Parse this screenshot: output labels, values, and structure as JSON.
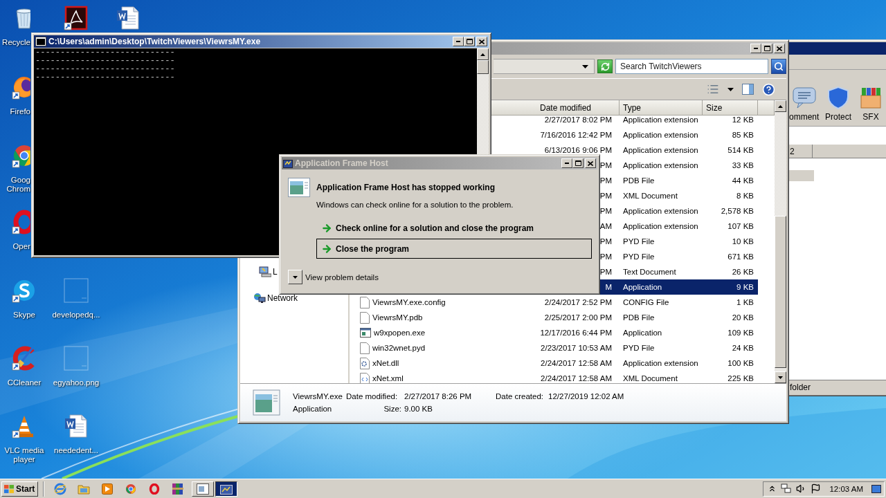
{
  "desktop": {
    "icons": [
      {
        "kind": "trash",
        "lines": [
          "Recycle"
        ],
        "clipped": true,
        "shortcut": false
      },
      {
        "kind": "app",
        "shortcut": true
      },
      {
        "kind": "document",
        "shortcut": false
      },
      {
        "kind": "firefox",
        "lines": [
          "Firefo"
        ],
        "clipped": true,
        "shortcut": true
      },
      {
        "kind": "chrome",
        "lines": [
          "Goog",
          "Chrom"
        ],
        "clipped": true,
        "shortcut": true
      },
      {
        "kind": "opera",
        "lines": [
          "Oper"
        ],
        "clipped": true,
        "shortcut": true
      },
      {
        "kind": "skype",
        "lines": [
          "Skype"
        ],
        "clipped": false,
        "shortcut": true
      },
      {
        "kind": "blank",
        "lines": [
          "developedq..."
        ],
        "clipped": false,
        "shortcut": false
      },
      {
        "kind": "cleaner",
        "lines": [
          "CCleaner"
        ],
        "clipped": false,
        "shortcut": true
      },
      {
        "kind": "blank",
        "lines": [
          "egyahoo.png"
        ],
        "clipped": false,
        "shortcut": false
      },
      {
        "kind": "cone",
        "lines": [
          "VLC media",
          "player"
        ],
        "clipped": false,
        "shortcut": true
      },
      {
        "kind": "document",
        "lines": [
          "neededent..."
        ],
        "clipped": false,
        "shortcut": false
      }
    ]
  },
  "background_window": {
    "toolbar": [
      {
        "kind": "comment",
        "label": "omment",
        "clipped": true
      },
      {
        "kind": "protect",
        "label": "Protect",
        "clipped": false
      },
      {
        "kind": "sfx",
        "label": "SFX",
        "clipped": false
      }
    ],
    "column_1": "2",
    "status": "folder"
  },
  "explorer": {
    "search": {
      "placeholder": "Search TwitchViewers"
    },
    "columns": [
      "Date modified",
      "Type",
      "Size"
    ],
    "rows": [
      {
        "date": "2/27/2017 8:02 PM",
        "type": "Application extension",
        "size": "12 KB",
        "selected": false
      },
      {
        "date": "7/16/2016 12:42 PM",
        "type": "Application extension",
        "size": "85 KB",
        "selected": false
      },
      {
        "date": "6/13/2016 9:06 PM",
        "type": "Application extension",
        "size": "514 KB",
        "selected": false
      },
      {
        "date": "PM",
        "type": "Application extension",
        "size": "33 KB",
        "selected": false
      },
      {
        "date": "PM",
        "type": "PDB File",
        "size": "44 KB",
        "selected": false
      },
      {
        "date": "PM",
        "type": "XML Document",
        "size": "8 KB",
        "selected": false
      },
      {
        "date": "PM",
        "type": "Application extension",
        "size": "2,578 KB",
        "selected": false
      },
      {
        "date": "AM",
        "type": "Application extension",
        "size": "107 KB",
        "selected": false
      },
      {
        "date": "PM",
        "type": "PYD File",
        "size": "10 KB",
        "selected": false
      },
      {
        "date": "PM",
        "type": "PYD File",
        "size": "671 KB",
        "selected": false
      },
      {
        "date": "PM",
        "type": "Text Document",
        "size": "26 KB",
        "selected": false
      },
      {
        "date": "M",
        "type": "Application",
        "size": "9 KB",
        "selected": true
      },
      {
        "name": "ViewrsMY.exe.config",
        "kind": "doc",
        "date": "2/24/2017 2:52 PM",
        "type": "CONFIG File",
        "size": "1 KB",
        "selected": false
      },
      {
        "name": "ViewrsMY.pdb",
        "kind": "doc",
        "date": "2/25/2017 2:00 PM",
        "type": "PDB File",
        "size": "20 KB",
        "selected": false
      },
      {
        "name": "w9xpopen.exe",
        "kind": "app",
        "date": "12/17/2016 6:44 PM",
        "type": "Application",
        "size": "109 KB",
        "selected": false
      },
      {
        "name": "win32wnet.pyd",
        "kind": "doc",
        "date": "2/23/2017 10:53 AM",
        "type": "PYD File",
        "size": "24 KB",
        "selected": false
      },
      {
        "name": "xNet.dll",
        "kind": "dll",
        "date": "2/24/2017 12:58 AM",
        "type": "Application extension",
        "size": "100 KB",
        "selected": false
      },
      {
        "name": "xNet.xml",
        "kind": "xml",
        "date": "2/24/2017 12:58 AM",
        "type": "XML Document",
        "size": "225 KB",
        "selected": false
      }
    ],
    "nav": [
      {
        "kind": "drive",
        "label": "L"
      },
      {
        "kind": "network",
        "label": "Network"
      }
    ],
    "details": {
      "name": "ViewrsMY.exe",
      "type": "Application",
      "modified_label": "Date modified:",
      "modified": "2/27/2017 8:26 PM",
      "created_label": "Date created:",
      "created": "12/27/2019 12:02 AM",
      "size_label": "Size:",
      "size": "9.00 KB"
    }
  },
  "console": {
    "title": "C:\\Users\\admin\\Desktop\\TwitchViewers\\ViewrsMY.exe",
    "lines": [
      "----------------------------",
      "----------------------------",
      "----------------------------",
      "----------------------------"
    ]
  },
  "dialog": {
    "title": "Application Frame Host",
    "heading": "Application Frame Host has stopped working",
    "message": "Windows can check online for a solution to the problem.",
    "options": [
      {
        "label": "Check online for a solution and close the program",
        "focused": false
      },
      {
        "label": "Close the program",
        "focused": true
      }
    ],
    "details_toggle": {
      "label": "View problem details",
      "expanded": false
    }
  },
  "taskbar": {
    "start": "Start",
    "quick_launch": [
      {
        "kind": "ie"
      },
      {
        "kind": "folder"
      },
      {
        "kind": "media"
      },
      {
        "kind": "chrome"
      },
      {
        "kind": "opera"
      },
      {
        "kind": "winrar"
      }
    ],
    "tasks": [
      {
        "kind": "explorer",
        "selected": false
      },
      {
        "kind": "appframe",
        "selected": true
      }
    ],
    "clock": "12:03 AM"
  }
}
